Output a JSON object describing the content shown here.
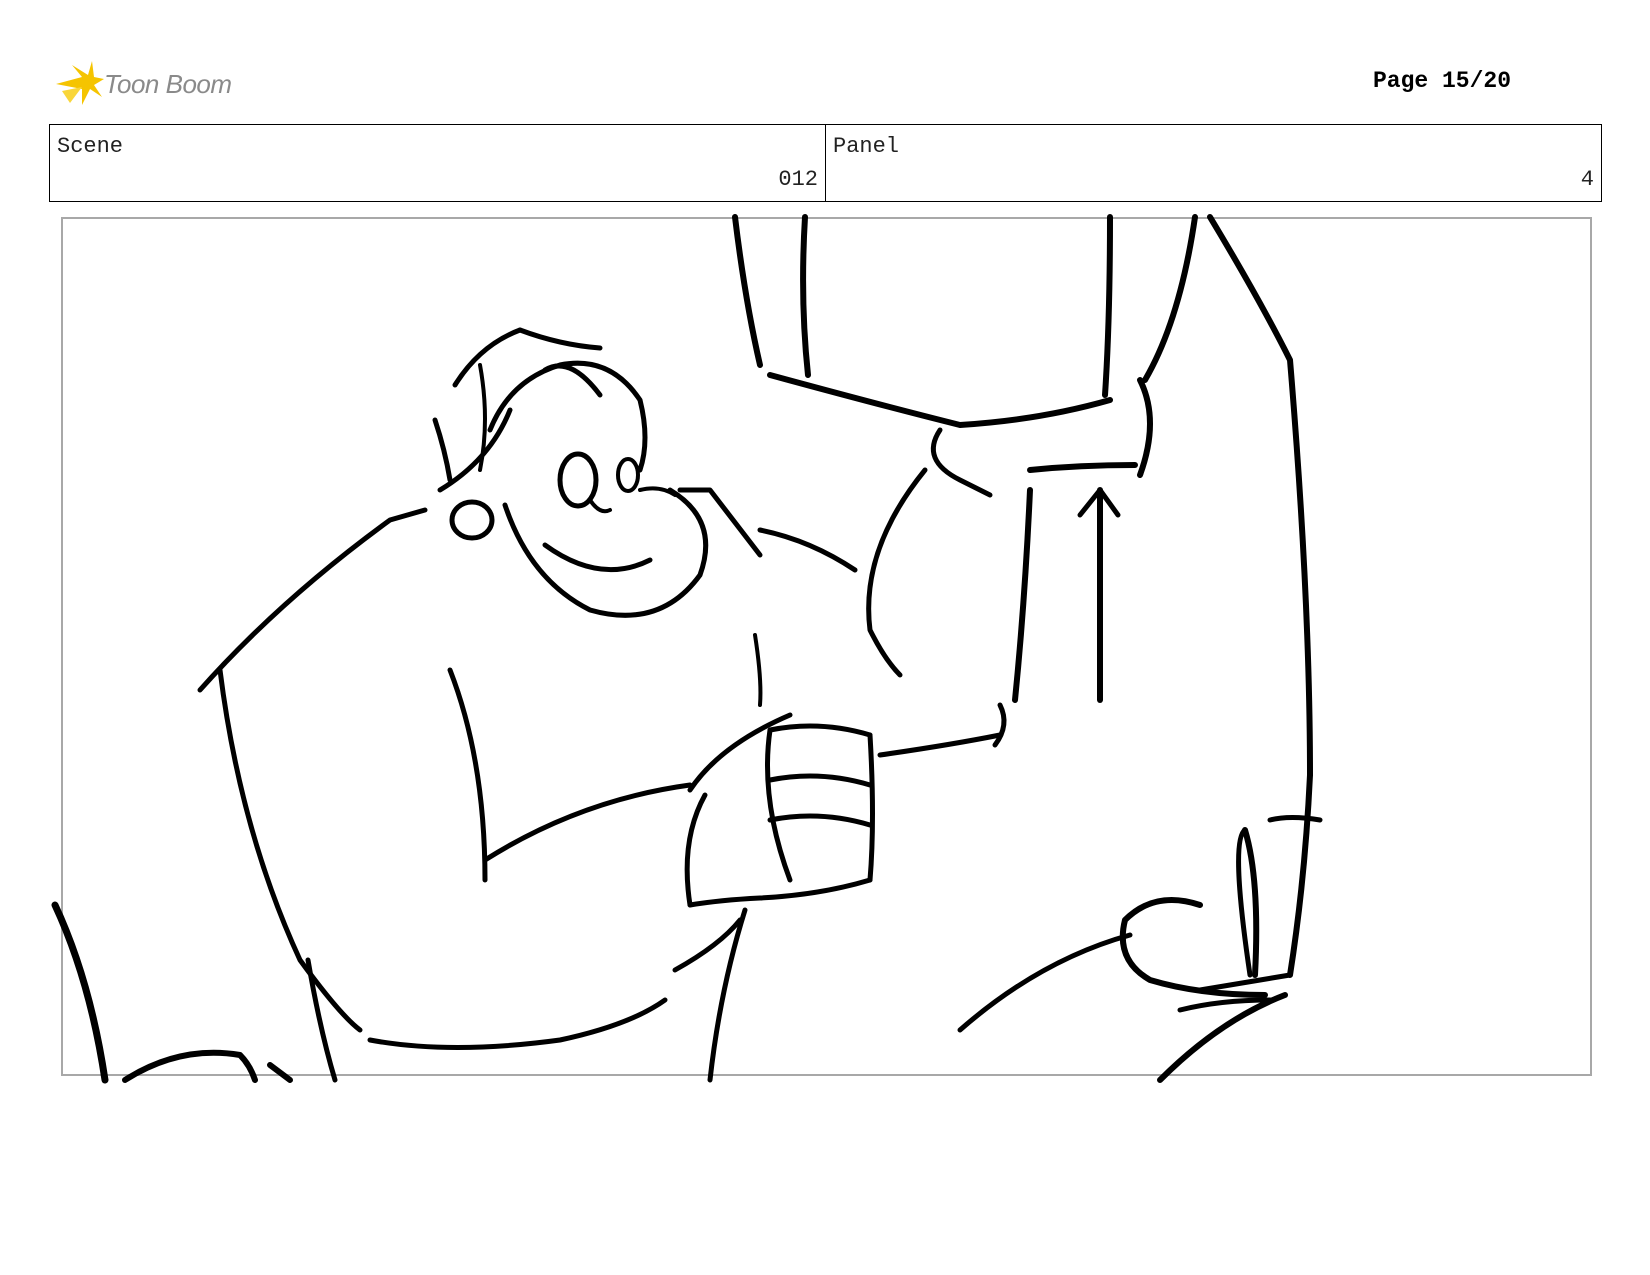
{
  "header": {
    "logo_text": "Toon Boom",
    "page_label": "Page 15/20"
  },
  "info": {
    "scene_label": "Scene",
    "scene_value": "012",
    "panel_label": "Panel",
    "panel_value": "4"
  },
  "colors": {
    "logo_accent": "#f5c400",
    "logo_text": "#8a8a8a",
    "frame_border": "#a8a8a8"
  }
}
